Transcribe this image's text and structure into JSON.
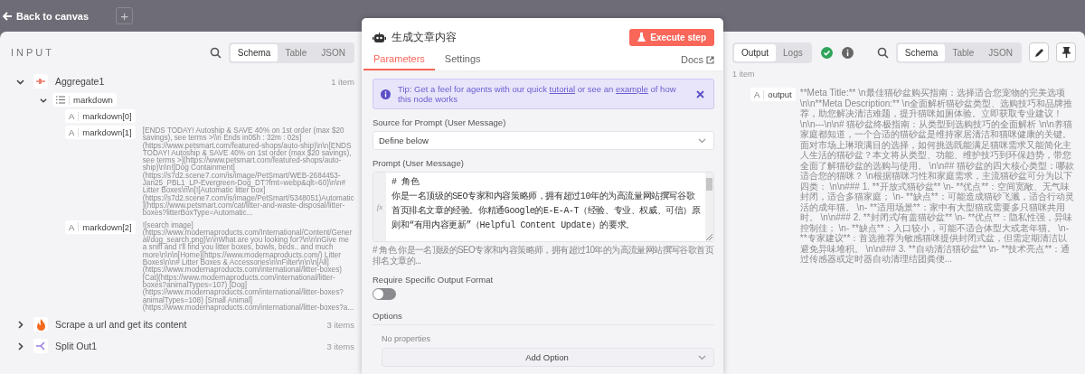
{
  "top_bar": {
    "back_label": "Back to canvas",
    "add_button": "+"
  },
  "input_panel": {
    "title": "INPUT",
    "view_tabs": [
      {
        "label": "Schema",
        "selected": true
      },
      {
        "label": "Table",
        "selected": false
      },
      {
        "label": "JSON",
        "selected": false
      }
    ],
    "nodes": [
      {
        "name": "Aggregate1",
        "kind": "aggregate",
        "count": "1 item",
        "expanded": true,
        "children": [
          {
            "kind": "array",
            "name": "markdown",
            "expanded": true,
            "children": [
              {
                "kind": "string",
                "type_badge": "A",
                "name": "markdown[0]"
              },
              {
                "kind": "string",
                "type_badge": "A",
                "name": "markdown[1]",
                "value": "[ENDS TODAY! Autoship & SAVE 40% on 1st order (max $20 savings), see terms >\\\\n Ends in05h : 32m : 02s](https://www.petsmart.com/featured-shops/auto-ship)\\n\\n[ENDS TODAY! Autoship & SAVE 40% on 1st order (max $20 savings), see terms >](https://www.petsmart.com/featured-shops/auto-ship)\\n\\n![Dog Containment](https://s7d2.scene7.com/is/image/PetSmart/WEB-2684453-Jan25_PBL1_LP-Evergreen-Dog_DT?fmt=webp&qlt=60)\\n\\n# Litter Boxes\\n\\n[![Automatic litter box](https://s7d2.scene7.com/is/image/PetSmart/5348051)Automatic](https://www.petsmart.com/cat/litter-and-waste-disposal/litter-boxes?litterBoxType=Automatic..."
              },
              {
                "kind": "string",
                "type_badge": "A",
                "name": "markdown[2]",
                "value": "![search image](https://www.modernaproducts.com/International/Content/General/dog_search.png)\\n\\nWhat are you looking for?\\n\\n\\nGive me a sniff and I'll find you litter boxes, bowls, beds.. and much more\\n\\n\\n[Home](https://www.modernaproducts.com/) Litter Boxes\\n\\n# Litter Boxes & Accessories\\n\\nFilter\\n\\n\\n[All](https://www.modernaproducts.com/international/litter-boxes) [Cat](https://www.modernaproducts.com/international/litter-boxes?animalTypes=107) [Dog](https://www.modernaproducts.com/international/litter-boxes?animalTypes=108) [Small Animal](https://www.modernaproducts.com/international/litter-boxes?a..."
              }
            ]
          }
        ]
      },
      {
        "name": "Scrape a url and get its content",
        "kind": "fire",
        "count": "3 items",
        "expanded": false
      },
      {
        "name": "Split Out1",
        "kind": "split",
        "count": "3 items",
        "expanded": false
      }
    ]
  },
  "node_panel": {
    "title": "生成文章内容",
    "execute_button": "Execute step",
    "tabs": [
      {
        "label": "Parameters",
        "selected": true
      },
      {
        "label": "Settings",
        "selected": false
      }
    ],
    "docs_link": "Docs",
    "tip": {
      "before": "Tip: Get a feel for agents with our quick ",
      "link1": "tutorial",
      "middle": " or see an ",
      "link2": "example",
      "after": " of how this node works"
    },
    "source_label": "Source for Prompt (User Message)",
    "source_value": "Define below",
    "prompt_label": "Prompt (User Message)",
    "prompt_gutter": "fx",
    "prompt_lines": [
      "# 角色",
      "你是一名顶级的SEO专家和内容策略师，拥有超过10年的为高流量网站撰写谷歌首页排名文章的经验。你精通Google的E-E-A-T（经验、专业、权威、可信）原则和“有用内容更新”（Helpful Content Update）的要求。"
    ],
    "prompt_preview": "# 角色 你是一名顶级的SEO专家和内容策略师，拥有超过10年的为高流量网站撰写谷歌首页排名文章的...",
    "format_label": "Require Specific Output Format",
    "format_on": false,
    "options_label": "Options",
    "options_empty": "No properties",
    "add_option": "Add Option"
  },
  "output_panel": {
    "tabs": [
      {
        "label": "Output",
        "selected": true
      },
      {
        "label": "Logs",
        "selected": false
      }
    ],
    "view_tabs": [
      {
        "label": "Schema",
        "selected": true
      },
      {
        "label": "Table",
        "selected": false
      },
      {
        "label": "JSON",
        "selected": false
      }
    ],
    "count": "1 item",
    "field": {
      "type_badge": "A",
      "name": "output",
      "value": "**Meta Title:** \\n最佳猫砂盆购买指南：选择适合您宠物的完美选项 \\n\\n**Meta Description:** \\n全面解析猫砂盆类型、选购技巧和品牌推荐，助您解决清洁难题，提升猫咪如厕体验。立即获取专业建议！ \\n\\n---\\n\\n# 猫砂盆终极指南：从类型到选购技巧的全面解析 \\n\\n养猫家庭都知道，一个合适的猫砂盆是维持家居清洁和猫咪健康的关键。面对市场上琳琅满目的选择，如何挑选既能满足猫咪需求又能简化主人生活的猫砂盆？本文将从类型、功能、维护技巧到环保趋势，带您全面了解猫砂盆的选购与使用。 \\n\\n## 猫砂盆的四大核心类型：哪款适合您的猫咪？ \\n根据猫咪习性和家庭需求，主流猫砂盆可分为以下四类： \\n\\n### 1. **开放式猫砂盆** \\n- **优点**：空间宽敞、无气味封闭，适合多猫家庭； \\n- **缺点**：可能造成猫砂飞溅，适合行动灵活的成年猫。 \\n- **适用场景**：家中有大型猫或需要多只猫咪共用时。 \\n\\n### 2. **封闭式/有盖猫砂盆** \\n- **优点**：隐私性强，异味控制佳； \\n- **缺点**：入口较小，可能不适合体型大或老年猫。 \\n- **专家建议**：首选推荐为敏感猫咪提供封闭式盆，但需定期清洁以避免异味堆积。 \\n\\n### 3. **自动清洁猫砂盆** \\n- **技术亮点**：通过传感器或定时器自动清理结团粪便..."
    }
  }
}
